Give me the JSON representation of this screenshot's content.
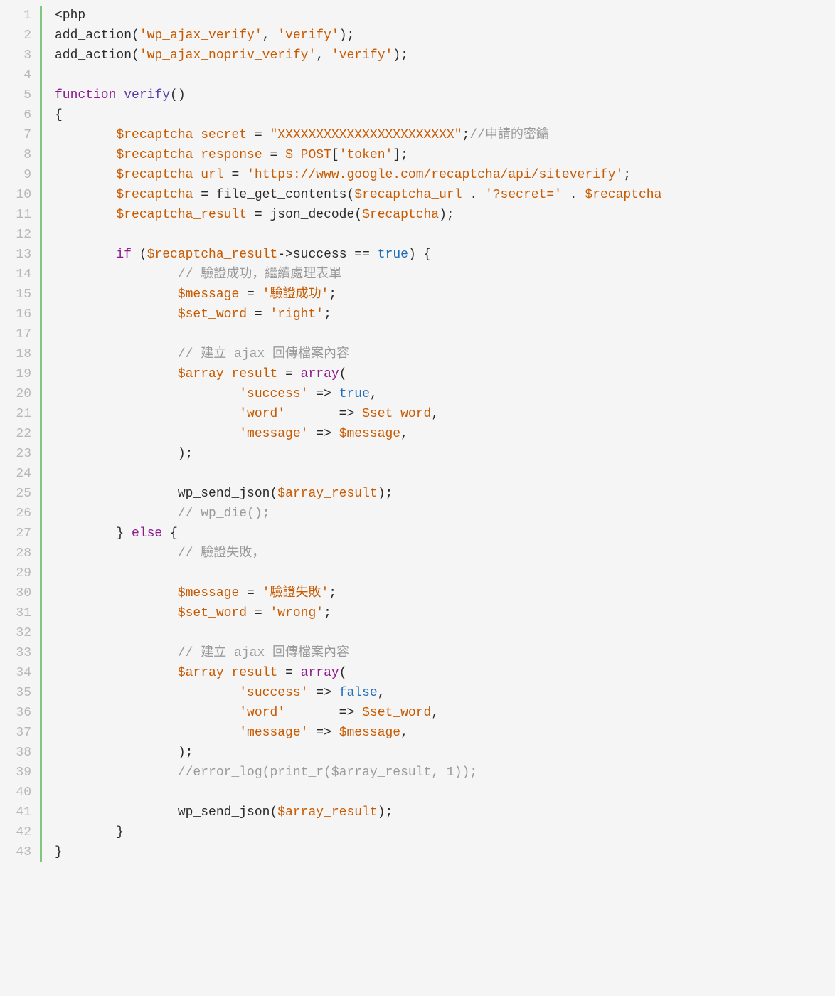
{
  "lines": [
    {
      "n": "1",
      "tokens": [
        {
          "t": "<php",
          "c": "plain"
        }
      ]
    },
    {
      "n": "2",
      "tokens": [
        {
          "t": "add_action(",
          "c": "plain"
        },
        {
          "t": "'wp_ajax_verify'",
          "c": "str"
        },
        {
          "t": ", ",
          "c": "plain"
        },
        {
          "t": "'verify'",
          "c": "str"
        },
        {
          "t": ");",
          "c": "plain"
        }
      ]
    },
    {
      "n": "3",
      "tokens": [
        {
          "t": "add_action(",
          "c": "plain"
        },
        {
          "t": "'wp_ajax_nopriv_verify'",
          "c": "str"
        },
        {
          "t": ", ",
          "c": "plain"
        },
        {
          "t": "'verify'",
          "c": "str"
        },
        {
          "t": ");",
          "c": "plain"
        }
      ]
    },
    {
      "n": "4",
      "tokens": []
    },
    {
      "n": "5",
      "tokens": [
        {
          "t": "function",
          "c": "kw"
        },
        {
          "t": " ",
          "c": "plain"
        },
        {
          "t": "verify",
          "c": "fn"
        },
        {
          "t": "()",
          "c": "plain"
        }
      ]
    },
    {
      "n": "6",
      "tokens": [
        {
          "t": "{",
          "c": "plain"
        }
      ]
    },
    {
      "n": "7",
      "tokens": [
        {
          "t": "        ",
          "c": "plain"
        },
        {
          "t": "$recaptcha_secret",
          "c": "var"
        },
        {
          "t": " = ",
          "c": "plain"
        },
        {
          "t": "\"XXXXXXXXXXXXXXXXXXXXXXX\"",
          "c": "str"
        },
        {
          "t": ";",
          "c": "plain"
        },
        {
          "t": "//申請的密鑰",
          "c": "cmt"
        }
      ]
    },
    {
      "n": "8",
      "tokens": [
        {
          "t": "        ",
          "c": "plain"
        },
        {
          "t": "$recaptcha_response",
          "c": "var"
        },
        {
          "t": " = ",
          "c": "plain"
        },
        {
          "t": "$_POST",
          "c": "var"
        },
        {
          "t": "[",
          "c": "plain"
        },
        {
          "t": "'token'",
          "c": "str"
        },
        {
          "t": "];",
          "c": "plain"
        }
      ]
    },
    {
      "n": "9",
      "tokens": [
        {
          "t": "        ",
          "c": "plain"
        },
        {
          "t": "$recaptcha_url",
          "c": "var"
        },
        {
          "t": " = ",
          "c": "plain"
        },
        {
          "t": "'https://www.google.com/recaptcha/api/siteverify'",
          "c": "str"
        },
        {
          "t": ";",
          "c": "plain"
        }
      ]
    },
    {
      "n": "10",
      "tokens": [
        {
          "t": "        ",
          "c": "plain"
        },
        {
          "t": "$recaptcha",
          "c": "var"
        },
        {
          "t": " = file_get_contents(",
          "c": "plain"
        },
        {
          "t": "$recaptcha_url",
          "c": "var"
        },
        {
          "t": " . ",
          "c": "plain"
        },
        {
          "t": "'?secret='",
          "c": "str"
        },
        {
          "t": " . ",
          "c": "plain"
        },
        {
          "t": "$recaptcha",
          "c": "var"
        }
      ]
    },
    {
      "n": "11",
      "tokens": [
        {
          "t": "        ",
          "c": "plain"
        },
        {
          "t": "$recaptcha_result",
          "c": "var"
        },
        {
          "t": " = json_decode(",
          "c": "plain"
        },
        {
          "t": "$recaptcha",
          "c": "var"
        },
        {
          "t": ");",
          "c": "plain"
        }
      ]
    },
    {
      "n": "12",
      "tokens": []
    },
    {
      "n": "13",
      "tokens": [
        {
          "t": "        ",
          "c": "plain"
        },
        {
          "t": "if",
          "c": "kw"
        },
        {
          "t": " (",
          "c": "plain"
        },
        {
          "t": "$recaptcha_result",
          "c": "var"
        },
        {
          "t": "->success == ",
          "c": "plain"
        },
        {
          "t": "true",
          "c": "bool"
        },
        {
          "t": ") {",
          "c": "plain"
        }
      ]
    },
    {
      "n": "14",
      "tokens": [
        {
          "t": "                ",
          "c": "plain"
        },
        {
          "t": "// 驗證成功，繼續處理表單",
          "c": "cmt"
        }
      ]
    },
    {
      "n": "15",
      "tokens": [
        {
          "t": "                ",
          "c": "plain"
        },
        {
          "t": "$message",
          "c": "var"
        },
        {
          "t": " = ",
          "c": "plain"
        },
        {
          "t": "'驗證成功'",
          "c": "str"
        },
        {
          "t": ";",
          "c": "plain"
        }
      ]
    },
    {
      "n": "16",
      "tokens": [
        {
          "t": "                ",
          "c": "plain"
        },
        {
          "t": "$set_word",
          "c": "var"
        },
        {
          "t": " = ",
          "c": "plain"
        },
        {
          "t": "'right'",
          "c": "str"
        },
        {
          "t": ";",
          "c": "plain"
        }
      ]
    },
    {
      "n": "17",
      "tokens": []
    },
    {
      "n": "18",
      "tokens": [
        {
          "t": "                ",
          "c": "plain"
        },
        {
          "t": "// 建立 ajax 回傳檔案內容",
          "c": "cmt"
        }
      ]
    },
    {
      "n": "19",
      "tokens": [
        {
          "t": "                ",
          "c": "plain"
        },
        {
          "t": "$array_result",
          "c": "var"
        },
        {
          "t": " = ",
          "c": "plain"
        },
        {
          "t": "array",
          "c": "kw"
        },
        {
          "t": "(",
          "c": "plain"
        }
      ]
    },
    {
      "n": "20",
      "tokens": [
        {
          "t": "                        ",
          "c": "plain"
        },
        {
          "t": "'success'",
          "c": "str"
        },
        {
          "t": " => ",
          "c": "plain"
        },
        {
          "t": "true",
          "c": "bool"
        },
        {
          "t": ",",
          "c": "plain"
        }
      ]
    },
    {
      "n": "21",
      "tokens": [
        {
          "t": "                        ",
          "c": "plain"
        },
        {
          "t": "'word'",
          "c": "str"
        },
        {
          "t": "       => ",
          "c": "plain"
        },
        {
          "t": "$set_word",
          "c": "var"
        },
        {
          "t": ",",
          "c": "plain"
        }
      ]
    },
    {
      "n": "22",
      "tokens": [
        {
          "t": "                        ",
          "c": "plain"
        },
        {
          "t": "'message'",
          "c": "str"
        },
        {
          "t": " => ",
          "c": "plain"
        },
        {
          "t": "$message",
          "c": "var"
        },
        {
          "t": ",",
          "c": "plain"
        }
      ]
    },
    {
      "n": "23",
      "tokens": [
        {
          "t": "                );",
          "c": "plain"
        }
      ]
    },
    {
      "n": "24",
      "tokens": []
    },
    {
      "n": "25",
      "tokens": [
        {
          "t": "                wp_send_json(",
          "c": "plain"
        },
        {
          "t": "$array_result",
          "c": "var"
        },
        {
          "t": ");",
          "c": "plain"
        }
      ]
    },
    {
      "n": "26",
      "tokens": [
        {
          "t": "                ",
          "c": "plain"
        },
        {
          "t": "// wp_die();",
          "c": "cmt"
        }
      ]
    },
    {
      "n": "27",
      "tokens": [
        {
          "t": "        } ",
          "c": "plain"
        },
        {
          "t": "else",
          "c": "kw"
        },
        {
          "t": " {",
          "c": "plain"
        }
      ]
    },
    {
      "n": "28",
      "tokens": [
        {
          "t": "                ",
          "c": "plain"
        },
        {
          "t": "// 驗證失敗，",
          "c": "cmt"
        }
      ]
    },
    {
      "n": "29",
      "tokens": []
    },
    {
      "n": "30",
      "tokens": [
        {
          "t": "                ",
          "c": "plain"
        },
        {
          "t": "$message",
          "c": "var"
        },
        {
          "t": " = ",
          "c": "plain"
        },
        {
          "t": "'驗證失敗'",
          "c": "str"
        },
        {
          "t": ";",
          "c": "plain"
        }
      ]
    },
    {
      "n": "31",
      "tokens": [
        {
          "t": "                ",
          "c": "plain"
        },
        {
          "t": "$set_word",
          "c": "var"
        },
        {
          "t": " = ",
          "c": "plain"
        },
        {
          "t": "'wrong'",
          "c": "str"
        },
        {
          "t": ";",
          "c": "plain"
        }
      ]
    },
    {
      "n": "32",
      "tokens": []
    },
    {
      "n": "33",
      "tokens": [
        {
          "t": "                ",
          "c": "plain"
        },
        {
          "t": "// 建立 ajax 回傳檔案內容",
          "c": "cmt"
        }
      ]
    },
    {
      "n": "34",
      "tokens": [
        {
          "t": "                ",
          "c": "plain"
        },
        {
          "t": "$array_result",
          "c": "var"
        },
        {
          "t": " = ",
          "c": "plain"
        },
        {
          "t": "array",
          "c": "kw"
        },
        {
          "t": "(",
          "c": "plain"
        }
      ]
    },
    {
      "n": "35",
      "tokens": [
        {
          "t": "                        ",
          "c": "plain"
        },
        {
          "t": "'success'",
          "c": "str"
        },
        {
          "t": " => ",
          "c": "plain"
        },
        {
          "t": "false",
          "c": "bool"
        },
        {
          "t": ",",
          "c": "plain"
        }
      ]
    },
    {
      "n": "36",
      "tokens": [
        {
          "t": "                        ",
          "c": "plain"
        },
        {
          "t": "'word'",
          "c": "str"
        },
        {
          "t": "       => ",
          "c": "plain"
        },
        {
          "t": "$set_word",
          "c": "var"
        },
        {
          "t": ",",
          "c": "plain"
        }
      ]
    },
    {
      "n": "37",
      "tokens": [
        {
          "t": "                        ",
          "c": "plain"
        },
        {
          "t": "'message'",
          "c": "str"
        },
        {
          "t": " => ",
          "c": "plain"
        },
        {
          "t": "$message",
          "c": "var"
        },
        {
          "t": ",",
          "c": "plain"
        }
      ]
    },
    {
      "n": "38",
      "tokens": [
        {
          "t": "                );",
          "c": "plain"
        }
      ]
    },
    {
      "n": "39",
      "tokens": [
        {
          "t": "                ",
          "c": "plain"
        },
        {
          "t": "//error_log(print_r($array_result, 1));",
          "c": "cmt"
        }
      ]
    },
    {
      "n": "40",
      "tokens": []
    },
    {
      "n": "41",
      "tokens": [
        {
          "t": "                wp_send_json(",
          "c": "plain"
        },
        {
          "t": "$array_result",
          "c": "var"
        },
        {
          "t": ");",
          "c": "plain"
        }
      ]
    },
    {
      "n": "42",
      "tokens": [
        {
          "t": "        }",
          "c": "plain"
        }
      ]
    },
    {
      "n": "43",
      "tokens": [
        {
          "t": "}",
          "c": "plain"
        }
      ]
    }
  ]
}
